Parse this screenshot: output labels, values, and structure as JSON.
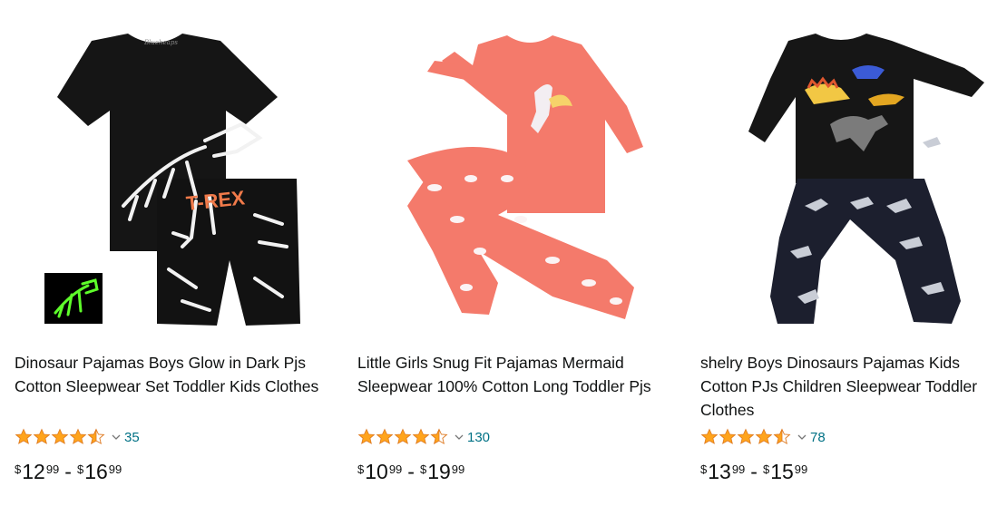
{
  "products": [
    {
      "title": "Dinosaur Pajamas Boys Glow in Dark Pjs Cotton Sleepwear Set Toddler Kids Clothes",
      "rating": 4.5,
      "review_count": "35",
      "price_low": {
        "symbol": "$",
        "whole": "12",
        "fraction": "99"
      },
      "price_separator": "-",
      "price_high": {
        "symbol": "$",
        "whole": "16",
        "fraction": "99"
      },
      "image_text": "T-REX",
      "image_brand": "Blueheaps"
    },
    {
      "title": "Little Girls Snug Fit Pajamas Mermaid Sleepwear 100% Cotton Long Toddler Pjs",
      "rating": 4.5,
      "review_count": "130",
      "price_low": {
        "symbol": "$",
        "whole": "10",
        "fraction": "99"
      },
      "price_separator": "-",
      "price_high": {
        "symbol": "$",
        "whole": "19",
        "fraction": "99"
      },
      "image_text": ""
    },
    {
      "title": "shelry Boys Dinosaurs Pajamas Kids Cotton PJs Children Sleepwear Toddler Clothes",
      "rating": 4.5,
      "review_count": "78",
      "price_low": {
        "symbol": "$",
        "whole": "13",
        "fraction": "99"
      },
      "price_separator": "-",
      "price_high": {
        "symbol": "$",
        "whole": "15",
        "fraction": "99"
      },
      "image_text": ""
    }
  ],
  "colors": {
    "star": "#ffa41c",
    "star_stroke": "#de7921",
    "link": "#007185",
    "text": "#0f1111"
  },
  "icons": [
    "star-full-icon",
    "star-half-icon",
    "chevron-down-icon"
  ]
}
